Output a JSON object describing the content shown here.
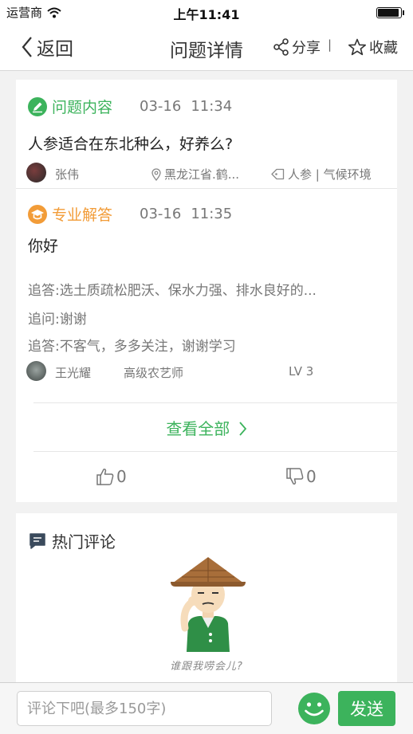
{
  "status_bar": {
    "carrier": "运营商",
    "time": "上午11:41",
    "wifi_icon": "wifi-icon",
    "battery_icon": "battery-icon"
  },
  "nav": {
    "back_label": "返回",
    "title": "问题详情",
    "share_label": "分享",
    "separator": "|",
    "favorite_label": "收藏"
  },
  "question": {
    "section_label": "问题内容",
    "date": "03-16",
    "time": "11:34",
    "text": "人参适合在东北种么，好养么?",
    "author": "张伟",
    "location": "黑龙江省.鹤...",
    "tags": "人参 | 气候环境"
  },
  "answer": {
    "section_label": "专业解答",
    "date": "03-16",
    "time": "11:35",
    "text": "你好",
    "followups": [
      "追答:选土质疏松肥沃、保水力强、排水良好的...",
      "追问:谢谢",
      "追答:不客气，多多关注，谢谢学习"
    ],
    "expert_name": "王光耀",
    "expert_title": "高级农艺师",
    "expert_level": "LV 3",
    "view_all_label": "查看全部",
    "likes": "0",
    "dislikes": "0"
  },
  "comments": {
    "section_label": "热门评论",
    "empty_text": "谁跟我唠会儿?"
  },
  "comment_bar": {
    "placeholder": "评论下吧(最多150字)",
    "send_label": "发送"
  },
  "colors": {
    "green": "#3cb35c",
    "orange": "#f29c38",
    "text": "#333333",
    "muted": "#777777",
    "background": "#f2f2f2"
  }
}
